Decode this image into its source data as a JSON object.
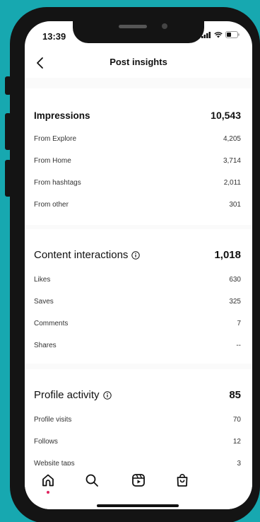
{
  "status_bar": {
    "time": "13:39"
  },
  "nav": {
    "title": "Post insights"
  },
  "impressions": {
    "title": "Impressions",
    "total": "10,543",
    "rows": [
      {
        "label": "From Explore",
        "value": "4,205"
      },
      {
        "label": "From Home",
        "value": "3,714"
      },
      {
        "label": "From hashtags",
        "value": "2,011"
      },
      {
        "label": "From other",
        "value": "301"
      }
    ]
  },
  "content_interactions": {
    "title": "Content interactions",
    "total": "1,018",
    "rows": [
      {
        "label": "Likes",
        "value": "630"
      },
      {
        "label": "Saves",
        "value": "325"
      },
      {
        "label": "Comments",
        "value": "7"
      },
      {
        "label": "Shares",
        "value": "--"
      }
    ]
  },
  "profile_activity": {
    "title": "Profile activity",
    "total": "85",
    "rows": [
      {
        "label": "Profile visits",
        "value": "70"
      },
      {
        "label": "Follows",
        "value": "12"
      },
      {
        "label": "Website taps",
        "value": "3"
      }
    ]
  },
  "tabbar": {
    "items": [
      "home-icon",
      "search-icon",
      "reels-icon",
      "shop-icon"
    ],
    "active": "home-icon"
  },
  "colors": {
    "background": "#17a8b0",
    "active_dot": "#e0245e"
  }
}
